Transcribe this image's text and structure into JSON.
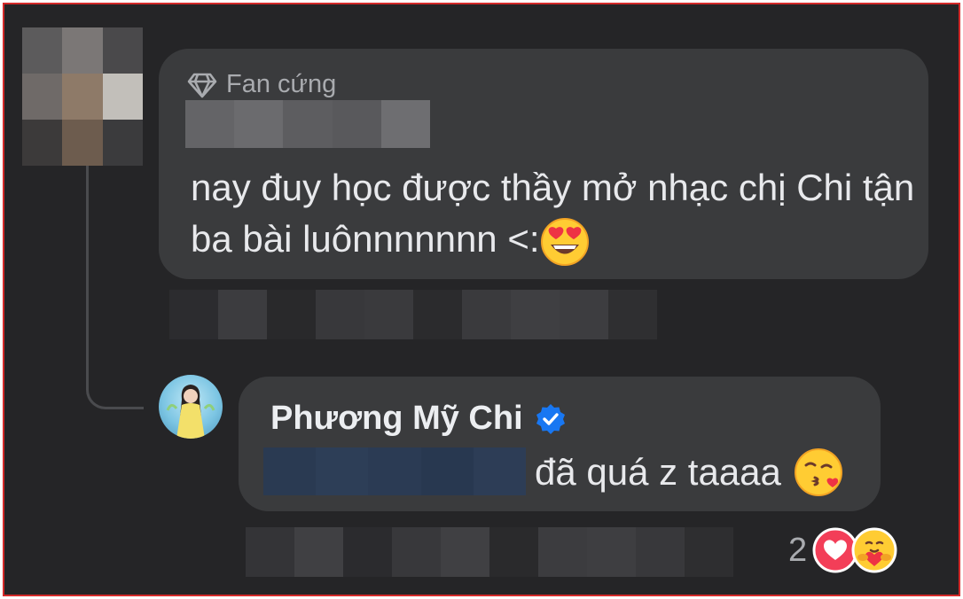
{
  "comment": {
    "badge_label": "Fan cứng",
    "text": "nay đuy học được thầy mở nhạc chị Chi tận ba bài luônnnnnnn <:",
    "emoji": "heart-eyes-face"
  },
  "reply": {
    "author": "Phương Mỹ Chi",
    "text": "đã quá z taaaa",
    "emoji": "face-blowing-kiss",
    "reaction_count": "2",
    "reactions": [
      "heart",
      "care"
    ]
  },
  "colors": {
    "background": "#252527",
    "bubble": "#3a3b3d",
    "text": "#e8e9ec",
    "muted": "#a9abaf",
    "verified": "#1877f2",
    "frame_border": "#d42a2a"
  }
}
